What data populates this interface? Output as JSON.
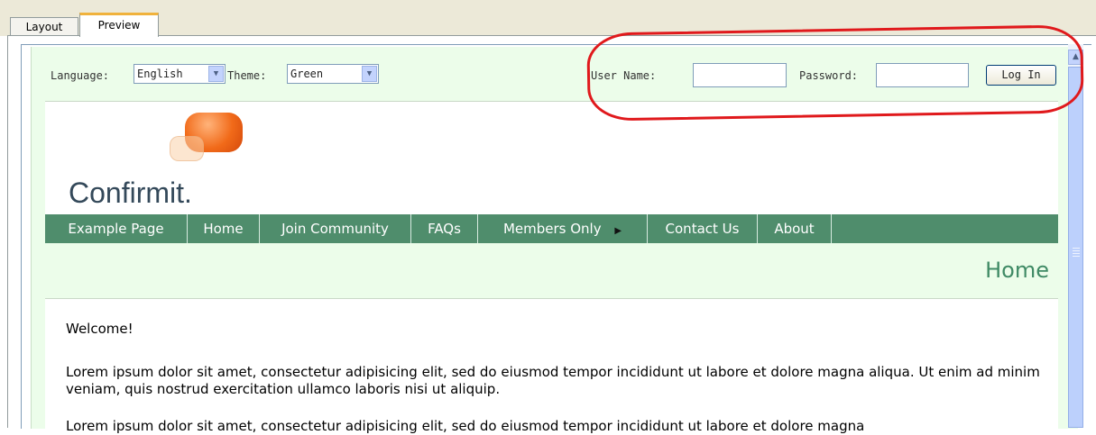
{
  "tabs": [
    {
      "label": "Layout"
    },
    {
      "label": "Preview"
    }
  ],
  "login_bar": {
    "language_label": "Language:",
    "language_value": "English",
    "theme_label": "Theme:",
    "theme_value": "Green",
    "username_label": "User Name:",
    "username_value": "",
    "password_label": "Password:",
    "password_value": "",
    "login_button": "Log In"
  },
  "logo": {
    "text": "Confirmit."
  },
  "nav": {
    "items": [
      {
        "label": "Example Page"
      },
      {
        "label": "Home"
      },
      {
        "label": "Join Community"
      },
      {
        "label": "FAQs"
      },
      {
        "label": "Members Only"
      },
      {
        "label": "Contact Us"
      },
      {
        "label": "About"
      }
    ]
  },
  "page": {
    "title": "Home"
  },
  "content": {
    "paragraphs": [
      "Welcome!",
      "Lorem ipsum dolor sit amet, consectetur adipisicing elit, sed do eiusmod tempor incididunt ut labore et dolore magna aliqua. Ut enim ad minim veniam, quis nostrud exercitation ullamco laboris nisi ut aliquip.",
      "Lorem ipsum dolor sit amet, consectetur adipisicing elit, sed do eiusmod tempor incididunt ut labore et dolore magna"
    ]
  },
  "colors": {
    "accent_green": "#4f8d6c",
    "page_background": "#ecfdea",
    "annotation_red": "#e0191c",
    "active_tab_highlight": "#f0b23c"
  },
  "icons": {
    "select_arrow": "chevron-down-icon",
    "members_submenu": "triangle-right-icon",
    "scroll_up": "arrow-up-icon"
  }
}
